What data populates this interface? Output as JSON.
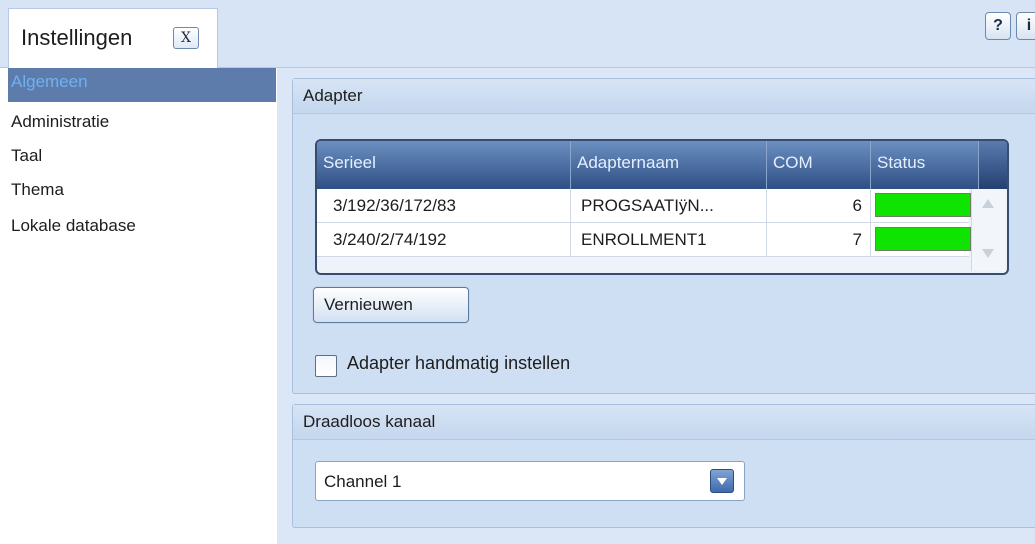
{
  "header": {
    "tab_title": "Instellingen",
    "close_label": "X",
    "help_label": "?",
    "info_label": "i"
  },
  "sidebar": {
    "items": [
      {
        "label": "Algemeen",
        "active": true
      },
      {
        "label": "Administratie",
        "active": false
      },
      {
        "label": "Taal",
        "active": false
      },
      {
        "label": "Thema",
        "active": false
      },
      {
        "label": "Lokale database",
        "active": false
      }
    ]
  },
  "adapter": {
    "title": "Adapter",
    "columns": [
      "Serieel",
      "Adapternaam",
      "COM",
      "Status"
    ],
    "rows": [
      {
        "serial": "3/192/36/172/83",
        "name": "PROGSAATIÿN...",
        "com": "6",
        "status_color": "#0fe300"
      },
      {
        "serial": "3/240/2/74/192",
        "name": "ENROLLMENT1",
        "com": "7",
        "status_color": "#0fe300"
      }
    ],
    "refresh_label": "Vernieuwen",
    "manual_checkbox_label": "Adapter handmatig instellen",
    "manual_checked": false
  },
  "wireless": {
    "title": "Draadloos kanaal",
    "selected_channel": "Channel 1"
  },
  "colors": {
    "status_ok": "#0fe300",
    "grid_header": "#2f4f84",
    "active_sidebar": "#5e7cab"
  }
}
